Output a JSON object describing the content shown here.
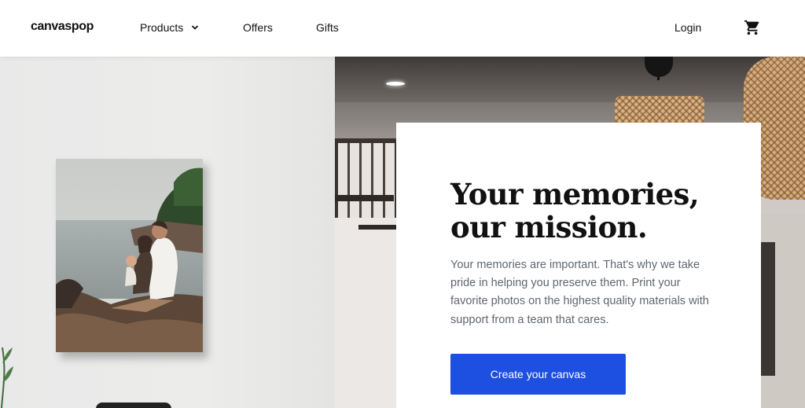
{
  "header": {
    "logo": "canvaspop",
    "nav": [
      {
        "label": "Products",
        "has_dropdown": true
      },
      {
        "label": "Offers"
      },
      {
        "label": "Gifts"
      }
    ],
    "login_label": "Login",
    "cart_icon": "shopping-cart-icon"
  },
  "hero": {
    "headline_line1": "Your memories,",
    "headline_line2": "our mission.",
    "body": "Your memories are important. That's why we take pride in helping you preserve them. Print your favorite photos on the highest quality materials with support from a team that cares.",
    "cta_label": "Create your canvas",
    "cta_color": "#1d4fe0",
    "image_description_icon": "family-photo-canvas"
  }
}
